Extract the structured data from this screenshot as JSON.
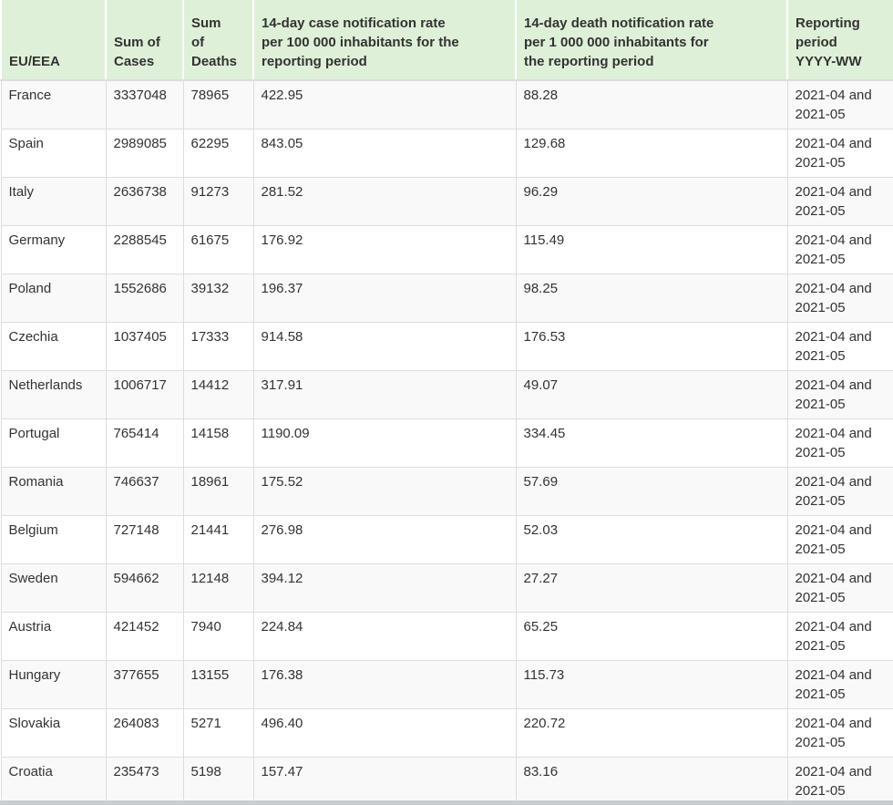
{
  "colors": {
    "header_bg": "#dff0d8",
    "stripe_row_bg": "#f9f9f9",
    "row_bg": "#ffffff",
    "border": "#dddddd",
    "text": "#333333",
    "scrollbar": "#c9cdd0"
  },
  "table": {
    "columns": [
      {
        "key": "country",
        "label": "EU/EEA"
      },
      {
        "key": "cases",
        "label": "Sum of\nCases"
      },
      {
        "key": "deaths",
        "label": "Sum\nof\nDeaths"
      },
      {
        "key": "case_rate",
        "label": "14-day case notification rate\nper 100 000 inhabitants for the\nreporting period"
      },
      {
        "key": "death_rate",
        "label": "14-day death notification rate\nper 1 000 000 inhabitants for\nthe reporting period"
      },
      {
        "key": "period",
        "label": "Reporting\nperiod\nYYYY-WW"
      }
    ],
    "rows": [
      {
        "country": "France",
        "cases": "3337048",
        "deaths": "78965",
        "case_rate": "422.95",
        "death_rate": "88.28",
        "period": "2021-04 and 2021-05"
      },
      {
        "country": "Spain",
        "cases": "2989085",
        "deaths": "62295",
        "case_rate": "843.05",
        "death_rate": "129.68",
        "period": "2021-04 and 2021-05"
      },
      {
        "country": "Italy",
        "cases": "2636738",
        "deaths": "91273",
        "case_rate": "281.52",
        "death_rate": "96.29",
        "period": "2021-04 and 2021-05"
      },
      {
        "country": "Germany",
        "cases": "2288545",
        "deaths": "61675",
        "case_rate": "176.92",
        "death_rate": "115.49",
        "period": "2021-04 and 2021-05"
      },
      {
        "country": "Poland",
        "cases": "1552686",
        "deaths": "39132",
        "case_rate": "196.37",
        "death_rate": "98.25",
        "period": "2021-04 and 2021-05"
      },
      {
        "country": "Czechia",
        "cases": "1037405",
        "deaths": "17333",
        "case_rate": "914.58",
        "death_rate": "176.53",
        "period": "2021-04 and 2021-05"
      },
      {
        "country": "Netherlands",
        "cases": "1006717",
        "deaths": "14412",
        "case_rate": "317.91",
        "death_rate": "49.07",
        "period": "2021-04 and 2021-05"
      },
      {
        "country": "Portugal",
        "cases": "765414",
        "deaths": "14158",
        "case_rate": "1190.09",
        "death_rate": "334.45",
        "period": "2021-04 and 2021-05"
      },
      {
        "country": "Romania",
        "cases": "746637",
        "deaths": "18961",
        "case_rate": "175.52",
        "death_rate": "57.69",
        "period": "2021-04 and 2021-05"
      },
      {
        "country": "Belgium",
        "cases": "727148",
        "deaths": "21441",
        "case_rate": "276.98",
        "death_rate": "52.03",
        "period": "2021-04 and 2021-05"
      },
      {
        "country": "Sweden",
        "cases": "594662",
        "deaths": "12148",
        "case_rate": "394.12",
        "death_rate": "27.27",
        "period": "2021-04 and 2021-05"
      },
      {
        "country": "Austria",
        "cases": "421452",
        "deaths": "7940",
        "case_rate": "224.84",
        "death_rate": "65.25",
        "period": "2021-04 and 2021-05"
      },
      {
        "country": "Hungary",
        "cases": "377655",
        "deaths": "13155",
        "case_rate": "176.38",
        "death_rate": "115.73",
        "period": "2021-04 and 2021-05"
      },
      {
        "country": "Slovakia",
        "cases": "264083",
        "deaths": "5271",
        "case_rate": "496.40",
        "death_rate": "220.72",
        "period": "2021-04 and 2021-05"
      },
      {
        "country": "Croatia",
        "cases": "235473",
        "deaths": "5198",
        "case_rate": "157.47",
        "death_rate": "83.16",
        "period": "2021-04 and 2021-05"
      }
    ]
  }
}
